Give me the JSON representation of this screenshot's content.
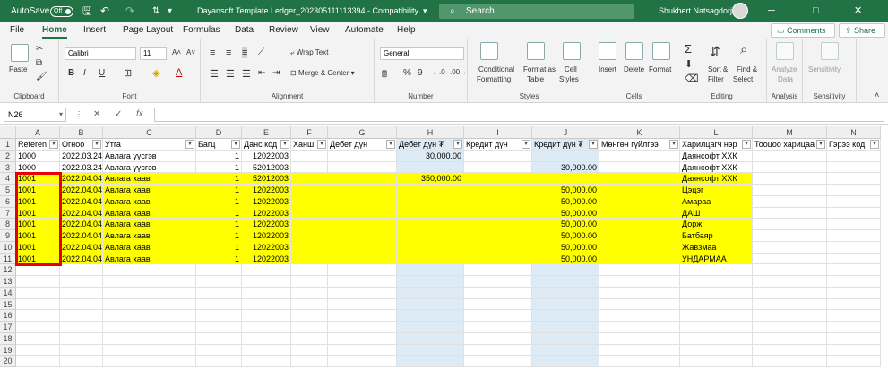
{
  "title_bar": {
    "autosave_label": "AutoSave",
    "autosave_state": "Off",
    "filename": "Dayansoft.Template.Ledger_202305111113394 - Compatibility...",
    "search_placeholder": "Search",
    "user_name": "Shukhert Natsagdorj"
  },
  "menu": {
    "tabs": [
      "File",
      "Home",
      "Insert",
      "Page Layout",
      "Formulas",
      "Data",
      "Review",
      "View",
      "Automate",
      "Help"
    ],
    "active_tab": "Home",
    "comments_label": "Comments",
    "share_label": "Share"
  },
  "ribbon": {
    "clipboard": {
      "paste": "Paste",
      "group_label": "Clipboard"
    },
    "font": {
      "name": "Calibri",
      "size": "11",
      "bold": "B",
      "italic": "I",
      "underline": "U",
      "group_label": "Font"
    },
    "alignment": {
      "wrap_text": "Wrap Text",
      "merge_center": "Merge & Center",
      "group_label": "Alignment"
    },
    "number": {
      "format": "General",
      "group_label": "Number"
    },
    "styles": {
      "conditional": "Conditional",
      "conditional2": "Formatting",
      "format_as": "Format as",
      "format_as2": "Table",
      "cell": "Cell",
      "cell2": "Styles",
      "group_label": "Styles"
    },
    "cells": {
      "insert": "Insert",
      "delete": "Delete",
      "format": "Format",
      "group_label": "Cells"
    },
    "editing": {
      "sort": "Sort &",
      "sort2": "Filter",
      "find": "Find &",
      "find2": "Select",
      "group_label": "Editing"
    },
    "analysis": {
      "analyze": "Analyze",
      "analyze2": "Data",
      "group_label": "Analysis"
    },
    "sensitivity": {
      "label": "Sensitivity",
      "group_label": "Sensitivity"
    }
  },
  "formula_bar": {
    "name_box": "N26",
    "cancel": "✕",
    "enter": "✓",
    "fx": "fx",
    "value": ""
  },
  "columns": [
    "A",
    "B",
    "C",
    "D",
    "E",
    "F",
    "G",
    "H",
    "I",
    "J",
    "K",
    "L",
    "M",
    "N"
  ],
  "rows": [
    [
      "Referen",
      "Огноо",
      "Утга",
      "Багц",
      "Данс код",
      "Ханш",
      "Дебет дүн",
      "Дебет дүн ₮",
      "Кредит дүн",
      "Кредит дүн ₮",
      "Мөнгөн гүйлгээ",
      "Харилцагч нэр",
      "Тооцоо харицаа",
      "Гэрээ код"
    ],
    [
      "1000",
      "2022.03.24",
      "Авлага үүсгэв",
      "1",
      "12022003",
      "",
      "",
      "30,000.00",
      "",
      "",
      "",
      "Даянсофт ХХК",
      "",
      ""
    ],
    [
      "1000",
      "2022.03.24",
      "Авлага үүсгэв",
      "1",
      "52012003",
      "",
      "",
      "",
      "",
      "30,000.00",
      "",
      "Даянсофт ХХК",
      "",
      ""
    ],
    [
      "1001",
      "2022.04.04",
      "Авлага хаав",
      "1",
      "52012003",
      "",
      "",
      "350,000.00",
      "",
      "",
      "",
      "Даянсофт ХХК",
      "",
      ""
    ],
    [
      "1001",
      "2022.04.04",
      "Авлага хаав",
      "1",
      "12022003",
      "",
      "",
      "",
      "",
      "50,000.00",
      "",
      "Цэцэг",
      "",
      ""
    ],
    [
      "1001",
      "2022.04.04",
      "Авлага хаав",
      "1",
      "12022003",
      "",
      "",
      "",
      "",
      "50,000.00",
      "",
      "Амараа",
      "",
      ""
    ],
    [
      "1001",
      "2022.04.04",
      "Авлага хаав",
      "1",
      "12022003",
      "",
      "",
      "",
      "",
      "50,000.00",
      "",
      "ДАШ",
      "",
      ""
    ],
    [
      "1001",
      "2022.04.04",
      "Авлага хаав",
      "1",
      "12022003",
      "",
      "",
      "",
      "",
      "50,000.00",
      "",
      "Дорж",
      "",
      ""
    ],
    [
      "1001",
      "2022.04.04",
      "Авлага хаав",
      "1",
      "12022003",
      "",
      "",
      "",
      "",
      "50,000.00",
      "",
      "Батбаяр",
      "",
      ""
    ],
    [
      "1001",
      "2022.04.04",
      "Авлага хаав",
      "1",
      "12022003",
      "",
      "",
      "",
      "",
      "50,000.00",
      "",
      "Жавзмаа",
      "",
      ""
    ],
    [
      "1001",
      "2022.04.04",
      "Авлага хаав",
      "1",
      "12022003",
      "",
      "",
      "",
      "",
      "50,000.00",
      "",
      "УНДАРМАА",
      "",
      ""
    ]
  ],
  "highlighted_rows": [
    4,
    5,
    6,
    7,
    8,
    9,
    10,
    11
  ],
  "total_rows": 20,
  "colors": {
    "accent": "#217346",
    "highlight_fill": "#ffff00",
    "selection_box": "#e60000",
    "amount_column_fill": "#ddebf7"
  }
}
